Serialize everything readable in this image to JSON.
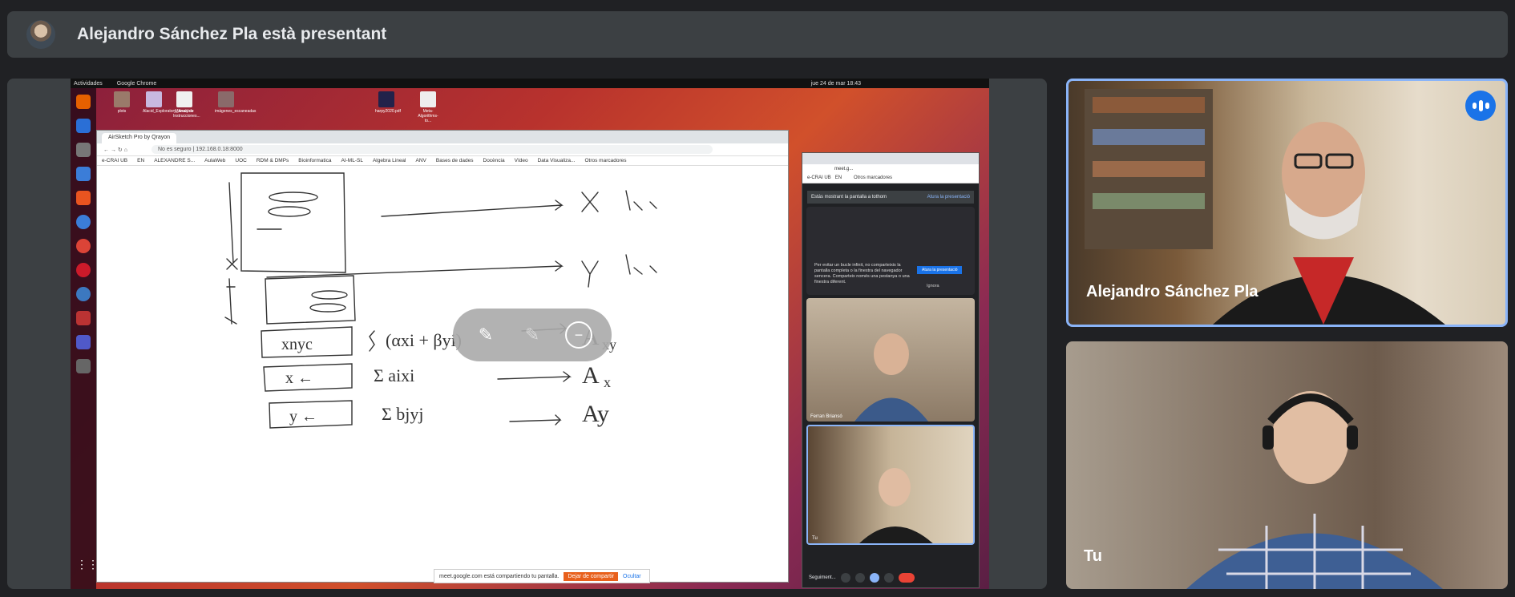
{
  "header": {
    "title": "Alejandro Sánchez Pla està presentant"
  },
  "shared_screen": {
    "ubuntu_bar": {
      "activities": "Actividades",
      "app": "Google Chrome",
      "clock": "jue 24 de mar  18:43"
    },
    "desktop_icons": [
      "plots",
      "Alacid_Exploratory_Analysis",
      "Manual de Instrucciones...",
      "imágenes_escaneadas",
      "harpy2020.pdf",
      "Meta-Algorithms-to..."
    ],
    "browser": {
      "tab_title": "AirSketch Pro by Qrayon",
      "url": "192.168.0.18:8000",
      "not_secure": "No es seguro",
      "bookmarks": [
        "e-CRAI UB",
        "EN",
        "ALEXANDRE S...",
        "AulaWeb",
        "UOC",
        "RDM & DMPs",
        "Bioinformatica",
        "AI-ML-SL",
        "Algebra Lineal",
        "ANV",
        "Bases de dades",
        "Docència",
        "Vídeo",
        "Data Visualiza..."
      ],
      "other_bookmarks": "Otros marcadores"
    },
    "sharing_bar": {
      "message": "meet.google.com está compartiendo tu pantalla.",
      "stop_label": "Dejar de compartir",
      "hide_label": "Ocultar"
    },
    "meet_window": {
      "addr": "meet.g...",
      "bookmark": "e-CRAI UB",
      "bookmark2": "EN",
      "other": "Otros marcadores",
      "notice": "Estás mostrant la pantalla a tothom",
      "notice_stop": "Atura la presentació",
      "infinite_msg": "Per evitar un bucle infinit, no comparteixis la pantalla completa o la finestra del navegador sencera. Comparteix només una pestanya o una finestra diferent.",
      "infinite_stop": "Atura la presentació",
      "infinite_ignore": "Ignora",
      "participant_name": "Ferran Briansó",
      "self_label": "Tu",
      "bottom_label": "Seguiment..."
    }
  },
  "participants": [
    {
      "name": "Alejandro Sánchez Pla",
      "speaking": true
    },
    {
      "name": "Tu",
      "speaking": false
    }
  ]
}
